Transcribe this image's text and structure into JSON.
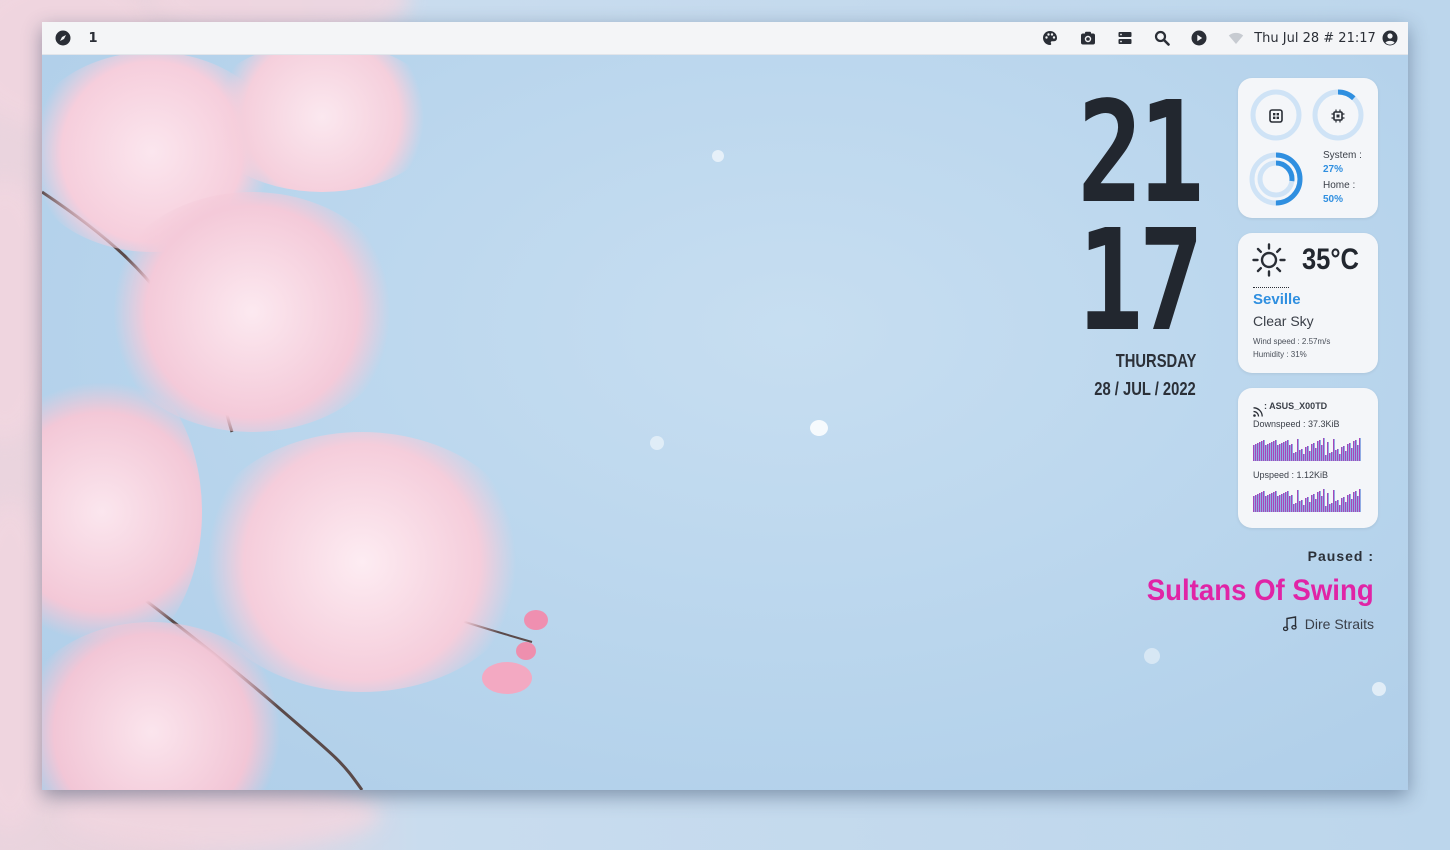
{
  "topbar": {
    "workspace": "1",
    "datetime": "Thu Jul 28 # 21:17",
    "icons": [
      "compass-icon",
      "palette-icon",
      "camera-icon",
      "server-icon",
      "search-icon",
      "play-icon",
      "wifi-icon",
      "account-icon"
    ]
  },
  "clock": {
    "hour": "21",
    "minute": "17",
    "day": "THURSDAY",
    "date": "28 / JUL / 2022"
  },
  "system": {
    "system_label": "System :",
    "system_value": "27%",
    "home_label": "Home :",
    "home_value": "50%",
    "ram_fraction": 0.0,
    "cpu_fraction": 0.12,
    "disk_fraction": 0.5
  },
  "weather": {
    "temperature": "35°C",
    "city": "Seville",
    "condition": "Clear Sky",
    "wind": "Wind speed : 2.57m/s",
    "humidity": "Humidity : 31%"
  },
  "network": {
    "ssid": ": ASUS_X00TD",
    "down": "Downspeed : 37.3KiB",
    "up": "Upspeed : 1.12KiB"
  },
  "music": {
    "status": "Paused :",
    "title": "Sultans Of Swing",
    "artist": "Dire Straits"
  },
  "colors": {
    "accent_blue": "#2f8fe0",
    "accent_pink": "#e024a6",
    "ring_track": "#cfe3f6"
  }
}
